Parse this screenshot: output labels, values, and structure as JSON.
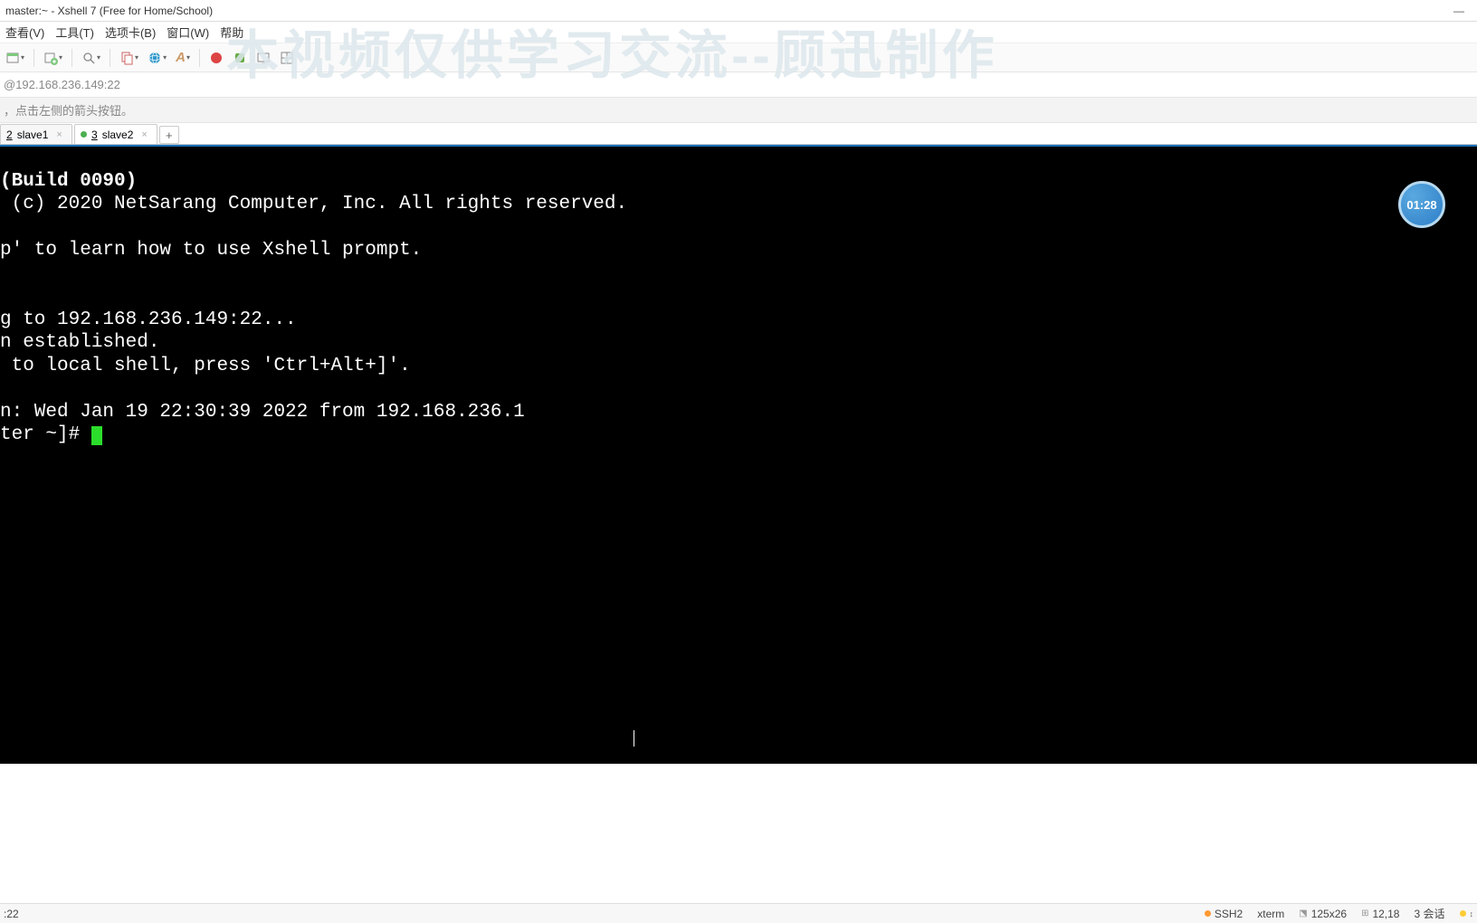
{
  "window": {
    "title": "master:~ - Xshell 7 (Free for Home/School)"
  },
  "menu": {
    "items": [
      "查看(V)",
      "工具(T)",
      "选项卡(B)",
      "窗口(W)",
      "帮助"
    ]
  },
  "toolbar": {
    "colors": {
      "new": "#7fc97f",
      "add": "#7fc97f",
      "search": "#888",
      "copy": "#cc6666",
      "globe": "#3399cc",
      "font": "#cc9966",
      "red": "#dd4444",
      "green": "#66aa44"
    }
  },
  "address": "@192.168.236.149:22",
  "hint": "，点击左侧的箭头按钮。",
  "tabs": {
    "items": [
      {
        "num": "2",
        "label": "slave1",
        "active": false,
        "dot": false
      },
      {
        "num": "3",
        "label": "slave2",
        "active": true,
        "dot": true
      }
    ]
  },
  "terminal": {
    "lines": [
      "(Build 0090)",
      " (c) 2020 NetSarang Computer, Inc. All rights reserved.",
      "",
      "p' to learn how to use Xshell prompt.",
      "",
      "",
      "g to 192.168.236.149:22...",
      "n established.",
      " to local shell, press 'Ctrl+Alt+]'.",
      "",
      "n: Wed Jan 19 22:30:39 2022 from 192.168.236.1",
      "ter ~]# "
    ]
  },
  "status": {
    "left": ":22",
    "ssh": "SSH2",
    "term": "xterm",
    "size": "125x26",
    "pos": "12,18",
    "sessions": "3 会话",
    "updown": "+"
  },
  "watermark": "本视频仅供学习交流--顾迅制作",
  "timer": "01:28"
}
